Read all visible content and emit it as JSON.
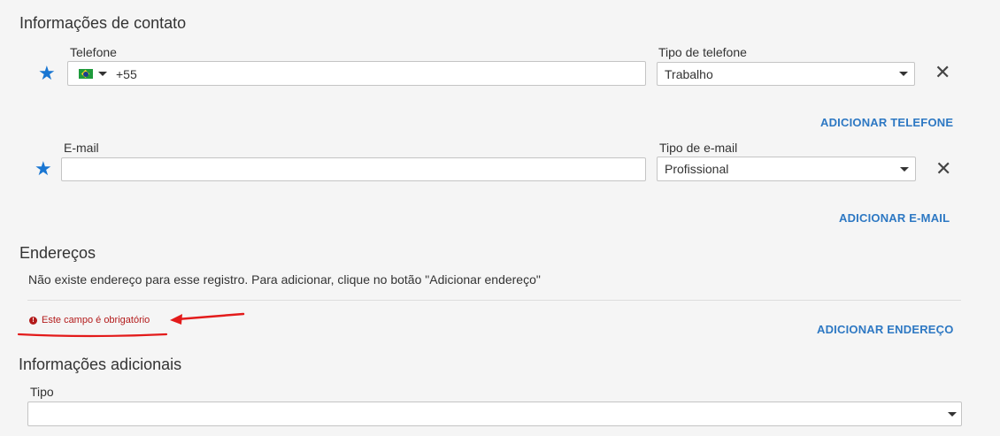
{
  "contact": {
    "title": "Informações de contato",
    "phone": {
      "label": "Telefone",
      "value": "+55",
      "type_label": "Tipo de telefone",
      "type_value": "Trabalho",
      "add_label": "ADICIONAR TELEFONE"
    },
    "email": {
      "label": "E-mail",
      "value": "",
      "type_label": "Tipo de e-mail",
      "type_value": "Profissional",
      "add_label": "ADICIONAR E-MAIL"
    }
  },
  "addresses": {
    "title": "Endereços",
    "empty_message": "Não existe endereço para esse registro. Para adicionar, clique no botão \"Adicionar endereço\"",
    "error_message": "Este campo é obrigatório",
    "add_label": "ADICIONAR ENDEREÇO"
  },
  "additional": {
    "title": "Informações adicionais",
    "type_label": "Tipo",
    "type_value": ""
  },
  "icons": {
    "star": "star-icon",
    "close": "close-icon",
    "flag": "brazil-flag-icon",
    "error": "error-icon"
  },
  "colors": {
    "accent": "#2d78c3",
    "star": "#1976d2",
    "error": "#b31b1b",
    "annotation": "#e31b1b"
  }
}
